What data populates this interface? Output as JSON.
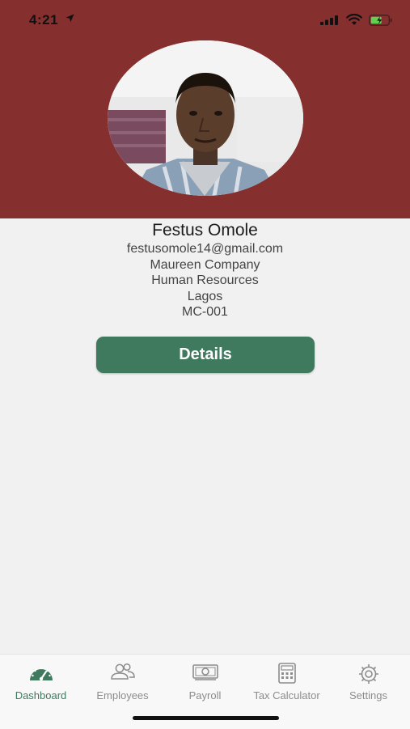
{
  "status_bar": {
    "time": "4:21"
  },
  "profile": {
    "name": "Festus Omole",
    "email": "festusomole14@gmail.com",
    "company": "Maureen Company",
    "department": "Human Resources",
    "location": "Lagos",
    "employee_id": "MC-001"
  },
  "details_button": {
    "label": "Details"
  },
  "tabs": [
    {
      "label": "Dashboard",
      "icon": "dashboard-icon",
      "active": true
    },
    {
      "label": "Employees",
      "icon": "employees-icon",
      "active": false
    },
    {
      "label": "Payroll",
      "icon": "payroll-icon",
      "active": false
    },
    {
      "label": "Tax Calculator",
      "icon": "calculator-icon",
      "active": false
    },
    {
      "label": "Settings",
      "icon": "gear-icon",
      "active": false
    }
  ],
  "colors": {
    "header": "#852f2f",
    "accent": "#3f7a5f",
    "background": "#f1f1f1",
    "tab_inactive": "#8c8c8c"
  }
}
